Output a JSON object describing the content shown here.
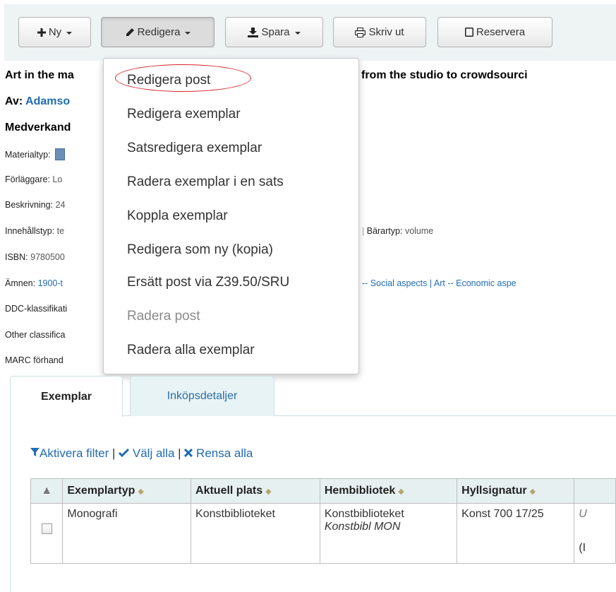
{
  "toolbar": {
    "new_label": "Ny",
    "edit_label": "Redigera",
    "save_label": "Spara",
    "print_label": "Skriv ut",
    "reserve_label": "Reservera"
  },
  "record": {
    "title_start": "Art in the ma",
    "title_end": "from the studio to crowdsourci",
    "author_label": "Av:",
    "author_name": "Adamso",
    "contributors_label": "Medverkand",
    "material_type_label": "Materialtyp:",
    "publisher_label": "Förläggare:",
    "publisher_value": "Lo",
    "description_label": "Beskrivning:",
    "description_value": "24",
    "content_type_label": "Innehållstyp:",
    "content_type_value": "te",
    "carrier_type_label": "Bärartyp:",
    "carrier_type_value": "volume",
    "isbn_label": "ISBN:",
    "isbn_value": "9780500",
    "subjects_label": "Ämnen:",
    "subjects_start": "1900-t",
    "subjects_end": "-- Social aspects | Art -- Economic aspe",
    "ddc_label": "DDC-klassifikati",
    "other_class_label": "Other classifica",
    "marc_label": "MARC förhand"
  },
  "edit_menu": {
    "items": [
      {
        "label": "Redigera post",
        "enabled": true
      },
      {
        "label": "Redigera exemplar",
        "enabled": true
      },
      {
        "label": "Satsredigera exemplar",
        "enabled": true
      },
      {
        "label": "Radera exemplar i en sats",
        "enabled": true
      },
      {
        "label": "Koppla exemplar",
        "enabled": true
      },
      {
        "label": "Redigera som ny (kopia)",
        "enabled": true
      },
      {
        "label": "Ersätt post via Z39.50/SRU",
        "enabled": true
      },
      {
        "label": "Radera post",
        "enabled": false
      },
      {
        "label": "Radera alla exemplar",
        "enabled": true
      }
    ],
    "highlight_color": "#d2262a"
  },
  "tabs": {
    "items_label": "Exemplar",
    "acquisitions_label": "Inköpsdetaljer"
  },
  "filters": {
    "activate_filter": "Aktivera filter",
    "select_all": "Välj alla",
    "clear_all": "Rensa alla",
    "separator": "|"
  },
  "items_table": {
    "headers": [
      "Exemplartyp",
      "Aktuell plats",
      "Hembibliotek",
      "Hyllsignatur"
    ],
    "rows": [
      {
        "item_type": "Monografi",
        "current_location": "Konstbiblioteket",
        "home_library": "Konstbiblioteket",
        "home_library_sub": "Konstbibl MON",
        "call_number": "Konst 700 17/25",
        "partial_1": "U",
        "partial_2": "(I"
      }
    ]
  },
  "colors": {
    "link": "#1f6bb6",
    "toolbar_bg": "#eef3f4",
    "table_header_bg": "#e7f0f1",
    "tab_inactive_bg": "#e8f3f5"
  }
}
